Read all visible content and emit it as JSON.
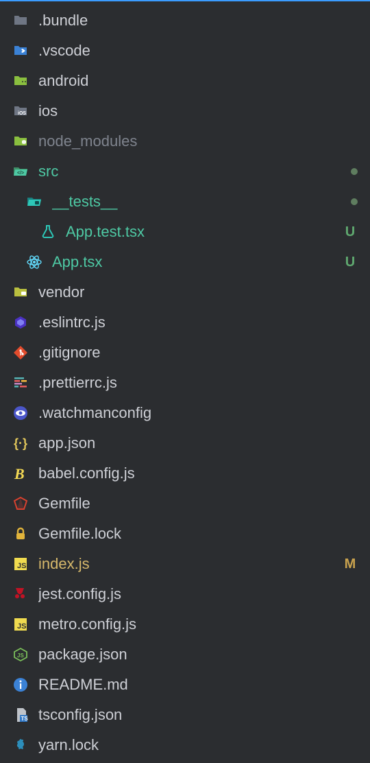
{
  "colors": {
    "default": "#ced0d6",
    "dim": "#7f848e",
    "green": "#4ec9a4",
    "yellow": "#d6b86b",
    "statusGreen": "#5fa86f",
    "statusYellow": "#c9a24e",
    "dotGreen": "#5f7d5f"
  },
  "items": [
    {
      "name": ".bundle",
      "icon": "folder",
      "indent": 0,
      "labelColor": "default"
    },
    {
      "name": ".vscode",
      "icon": "folder-vscode",
      "indent": 0,
      "labelColor": "default"
    },
    {
      "name": "android",
      "icon": "folder-android",
      "indent": 0,
      "labelColor": "default"
    },
    {
      "name": "ios",
      "icon": "folder-ios",
      "indent": 0,
      "labelColor": "default"
    },
    {
      "name": "node_modules",
      "icon": "folder-node",
      "indent": 0,
      "labelColor": "dim"
    },
    {
      "name": "src",
      "icon": "folder-src-open",
      "indent": 0,
      "labelColor": "green",
      "dot": true
    },
    {
      "name": "__tests__",
      "icon": "folder-tests-open",
      "indent": 1,
      "labelColor": "green",
      "dot": true
    },
    {
      "name": "App.test.tsx",
      "icon": "flask",
      "indent": 2,
      "labelColor": "green",
      "status": "U",
      "statusColor": "statusGreen"
    },
    {
      "name": "App.tsx",
      "icon": "react",
      "indent": 1,
      "labelColor": "green",
      "status": "U",
      "statusColor": "statusGreen"
    },
    {
      "name": "vendor",
      "icon": "folder-vendor",
      "indent": 0,
      "labelColor": "default"
    },
    {
      "name": ".eslintrc.js",
      "icon": "eslint",
      "indent": 0,
      "labelColor": "default"
    },
    {
      "name": ".gitignore",
      "icon": "git",
      "indent": 0,
      "labelColor": "default"
    },
    {
      "name": ".prettierrc.js",
      "icon": "prettier",
      "indent": 0,
      "labelColor": "default"
    },
    {
      "name": ".watchmanconfig",
      "icon": "watchman",
      "indent": 0,
      "labelColor": "default"
    },
    {
      "name": "app.json",
      "icon": "json-braces",
      "indent": 0,
      "labelColor": "default"
    },
    {
      "name": "babel.config.js",
      "icon": "babel",
      "indent": 0,
      "labelColor": "default"
    },
    {
      "name": "Gemfile",
      "icon": "ruby",
      "indent": 0,
      "labelColor": "default"
    },
    {
      "name": "Gemfile.lock",
      "icon": "lock",
      "indent": 0,
      "labelColor": "default"
    },
    {
      "name": "index.js",
      "icon": "js",
      "indent": 0,
      "labelColor": "yellow",
      "status": "M",
      "statusColor": "statusYellow"
    },
    {
      "name": "jest.config.js",
      "icon": "jest",
      "indent": 0,
      "labelColor": "default"
    },
    {
      "name": "metro.config.js",
      "icon": "js",
      "indent": 0,
      "labelColor": "default"
    },
    {
      "name": "package.json",
      "icon": "npm",
      "indent": 0,
      "labelColor": "default"
    },
    {
      "name": "README.md",
      "icon": "info",
      "indent": 0,
      "labelColor": "default"
    },
    {
      "name": "tsconfig.json",
      "icon": "tsconfig",
      "indent": 0,
      "labelColor": "default"
    },
    {
      "name": "yarn.lock",
      "icon": "yarn",
      "indent": 0,
      "labelColor": "default"
    }
  ]
}
